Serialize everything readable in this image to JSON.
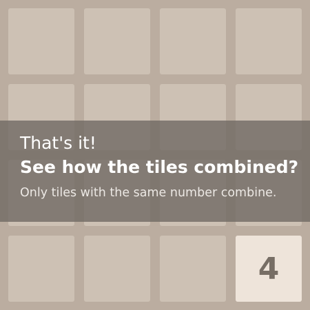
{
  "board": {
    "size": 4,
    "colors": {
      "background": "#bbada0",
      "empty_cell": "#cdc1b4",
      "tile_4": "#eee4da",
      "tile_text": "#776e65"
    },
    "tiles": [
      {
        "row": 3,
        "col": 3,
        "value": "4"
      }
    ]
  },
  "tutorial": {
    "heading": "That's it!",
    "question": "See how the tiles combined?",
    "hint": "Only tiles with the same number combine."
  }
}
